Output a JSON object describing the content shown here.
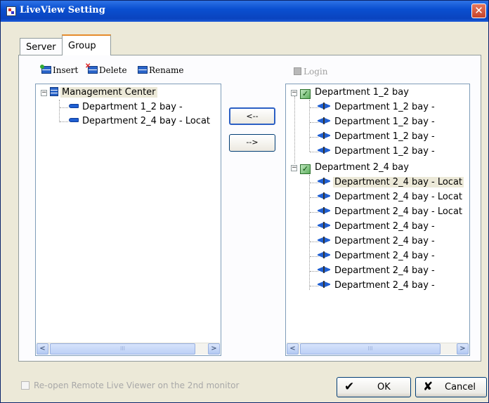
{
  "window": {
    "title": "LiveView Setting",
    "close_glyph": "✕"
  },
  "tabs": [
    {
      "label": "Server"
    },
    {
      "label": "Group"
    }
  ],
  "toolbar": {
    "insert": "Insert",
    "delete": "Delete",
    "rename": "Rename",
    "login": "Login"
  },
  "left_tree": {
    "root": "Management Center",
    "children": [
      "Department 1_2 bay -",
      "Department 2_4 bay - Locat"
    ]
  },
  "right_tree": {
    "groups": [
      {
        "label": "Department 1_2 bay",
        "children": [
          "Department 1_2 bay -",
          "Department 1_2 bay -",
          "Department 1_2 bay -",
          "Department 1_2 bay -"
        ]
      },
      {
        "label": "Department 2_4 bay",
        "children": [
          "Department 2_4 bay - Locat",
          "Department 2_4 bay - Locat",
          "Department 2_4 bay - Locat",
          "Department 2_4 bay -",
          "Department 2_4 bay -",
          "Department 2_4 bay -",
          "Department 2_4 bay -",
          "Department 2_4 bay -"
        ]
      }
    ]
  },
  "move_buttons": {
    "to_left": "<--",
    "to_right": "-->"
  },
  "scroll_glyphs": {
    "left": "<",
    "right": ">",
    "grip": "III"
  },
  "reopen_label": "Re-open Remote Live Viewer on the 2nd monitor",
  "ok_label": "OK",
  "cancel_label": "Cancel",
  "ok_glyph": "✔",
  "cancel_glyph": "✘",
  "colors": {
    "title_bar": "#0a4fd0",
    "selection": "#ece9d8",
    "active_tab": "#e68b2c"
  }
}
